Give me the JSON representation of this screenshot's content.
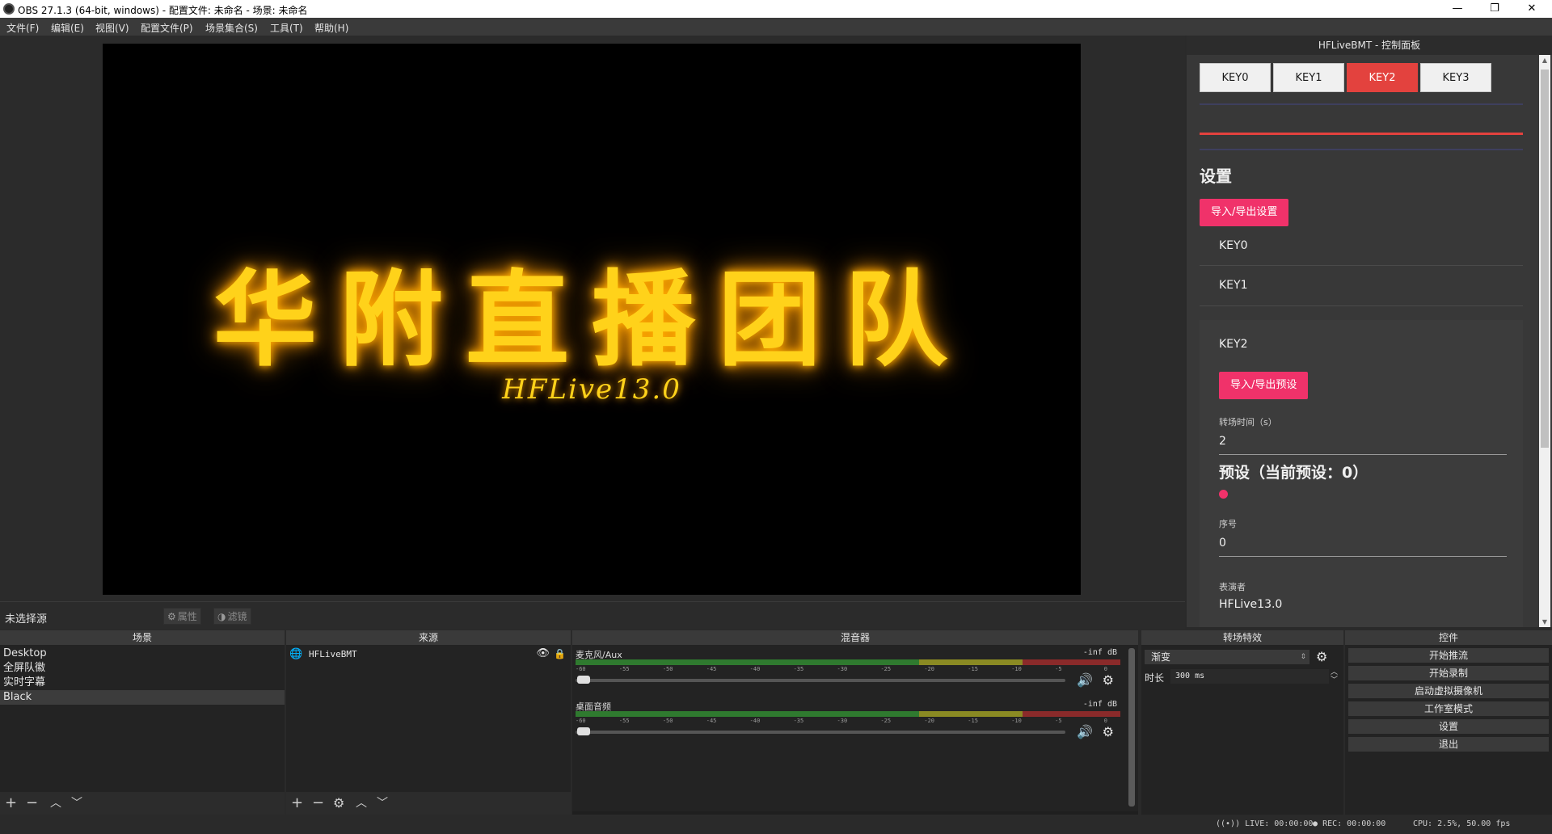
{
  "window": {
    "title": "OBS 27.1.3 (64-bit, windows) - 配置文件: 未命名 - 场景: 未命名",
    "minimize": "—",
    "maximize": "❐",
    "close": "✕"
  },
  "menu": [
    "文件(F)",
    "编辑(E)",
    "视图(V)",
    "配置文件(P)",
    "场景集合(S)",
    "工具(T)",
    "帮助(H)"
  ],
  "preview": {
    "title_text": "华附直播团队",
    "subtitle_text": "HFLive13.0"
  },
  "source_toolbar": {
    "label": "未选择源",
    "properties": "属性",
    "filters": "滤镜"
  },
  "scenes": {
    "title": "场景",
    "items": [
      "Desktop",
      "全屏队徽",
      "实时字幕",
      "Black"
    ],
    "selected": "Black"
  },
  "sources": {
    "title": "来源",
    "items": [
      "HFLiveBMT"
    ]
  },
  "mixer": {
    "title": "混音器",
    "channels": [
      {
        "name": "麦克风/Aux",
        "db": "-inf dB"
      },
      {
        "name": "桌面音频",
        "db": "-inf dB"
      }
    ],
    "scale": [
      "-60",
      "-55",
      "-50",
      "-45",
      "-40",
      "-35",
      "-30",
      "-25",
      "-20",
      "-15",
      "-10",
      "-5",
      "0"
    ]
  },
  "transitions": {
    "title": "转场特效",
    "selected": "渐变",
    "duration_label": "时长",
    "duration_value": "300 ms"
  },
  "controls": {
    "title": "控件",
    "buttons": [
      "开始推流",
      "开始录制",
      "启动虚拟摄像机",
      "工作室模式",
      "设置",
      "退出"
    ]
  },
  "status": {
    "live": "LIVE: 00:00:00",
    "rec": "REC: 00:00:00",
    "cpu": "CPU: 2.5%, 50.00 fps"
  },
  "panel": {
    "title": "HFLiveBMT - 控制面板",
    "tabs": [
      "KEY0",
      "KEY1",
      "KEY2",
      "KEY3"
    ],
    "active_tab": "KEY2",
    "settings_heading": "设置",
    "import_export_settings": "导入/导出设置",
    "key0": "KEY0",
    "key1": "KEY1",
    "key2": "KEY2",
    "import_export_preset": "导入/导出预设",
    "transition_time_label": "转场时间（s）",
    "transition_time_value": "2",
    "preset_heading": "预设（当前预设：0）",
    "index_label": "序号",
    "index_value": "0",
    "performer_label": "表演者",
    "performer_value": "HFLive13.0"
  },
  "colors": {
    "accent_red": "#e3423e",
    "accent_pink": "#f0326a",
    "title_gold": "#ffd21a"
  }
}
